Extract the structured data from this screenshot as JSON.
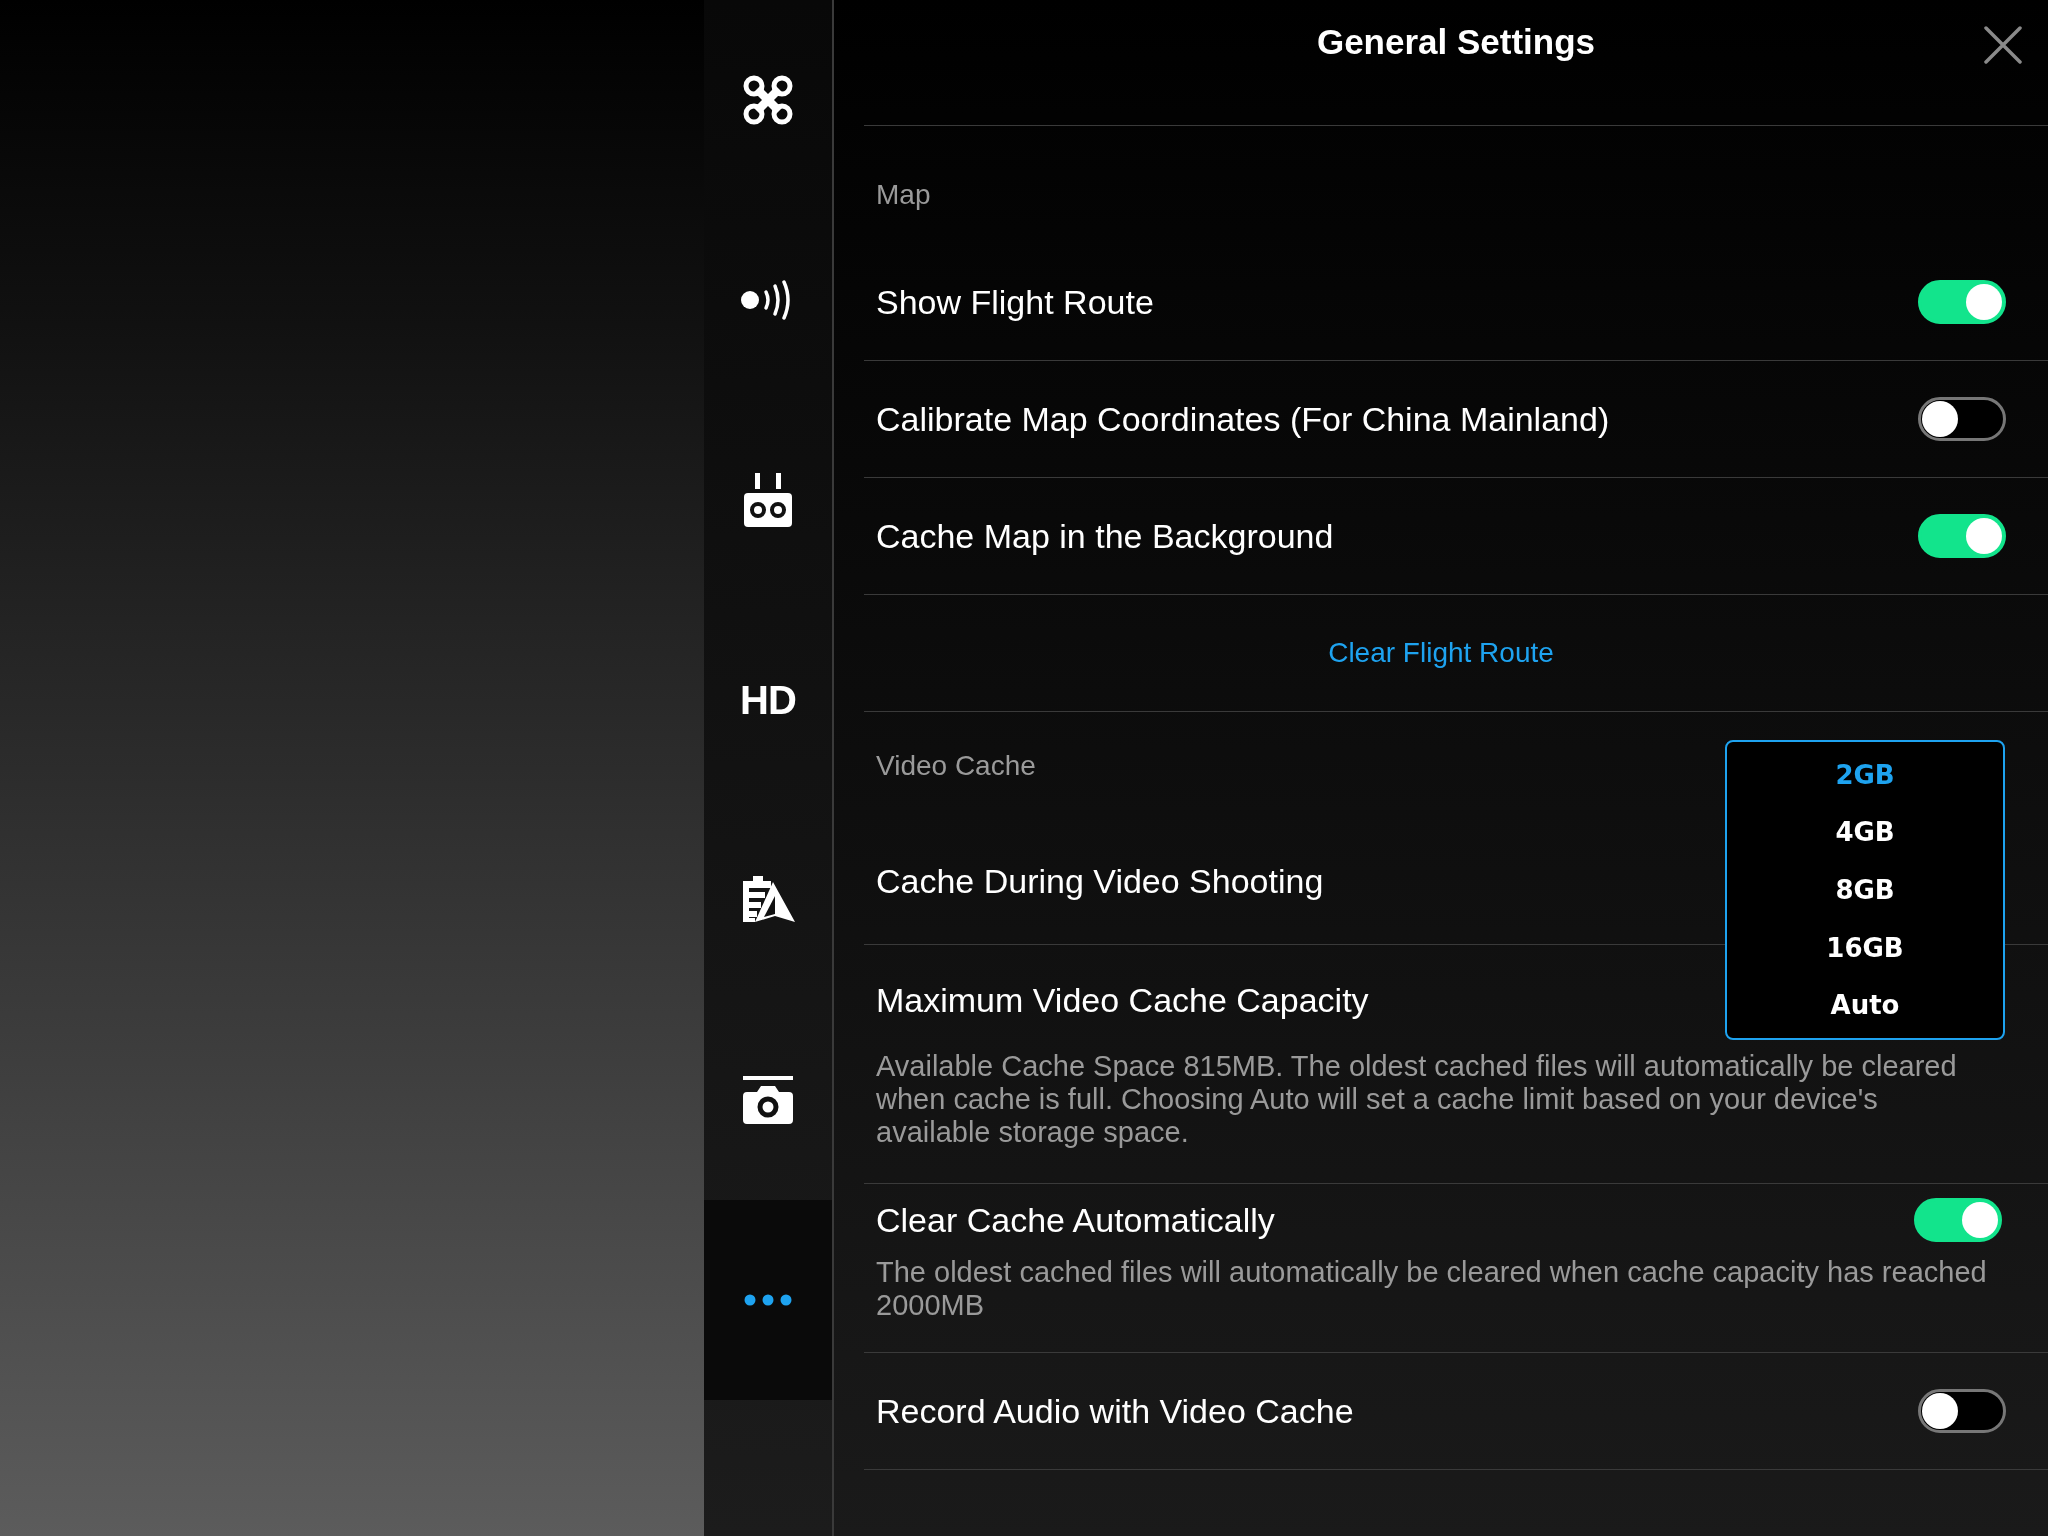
{
  "window": {
    "title": "General Settings"
  },
  "sidebar": {
    "items": [
      {
        "kind": "drone",
        "selected": false
      },
      {
        "kind": "signal",
        "selected": false
      },
      {
        "kind": "remote",
        "selected": false
      },
      {
        "kind": "text",
        "label": "HD",
        "selected": false
      },
      {
        "kind": "battery",
        "selected": false
      },
      {
        "kind": "camera",
        "selected": false
      },
      {
        "kind": "more",
        "selected": true
      }
    ]
  },
  "sections": [
    {
      "header": "Map",
      "rows": [
        {
          "kind": "toggle",
          "label": "Show Flight Route",
          "on": true
        },
        {
          "kind": "toggle",
          "label": "Calibrate Map Coordinates (For China Mainland)",
          "on": false
        },
        {
          "kind": "toggle",
          "label": "Cache Map in the Background",
          "on": true
        },
        {
          "kind": "action",
          "label": "Clear Flight Route"
        }
      ]
    },
    {
      "header": "Video Cache",
      "rows": [
        {
          "kind": "label",
          "label": "Cache During Video Shooting"
        },
        {
          "kind": "dropdown",
          "label": "Maximum Video Cache Capacity",
          "description": "Available Cache Space 815MB. The oldest cached files will automatically be cleared when cache is full. Choosing Auto will set a cache limit based on your device's available storage space.",
          "options": [
            {
              "label": "2GB",
              "selected": true
            },
            {
              "label": "4GB",
              "selected": false
            },
            {
              "label": "8GB",
              "selected": false
            },
            {
              "label": "16GB",
              "selected": false
            },
            {
              "label": "Auto",
              "selected": false
            }
          ]
        },
        {
          "kind": "toggle",
          "label": "Clear Cache Automatically",
          "on": true,
          "description": "The oldest cached files will automatically be cleared when cache capacity has reached 2000MB"
        },
        {
          "kind": "toggle",
          "label": "Record Audio with Video Cache",
          "on": false
        }
      ]
    }
  ]
}
